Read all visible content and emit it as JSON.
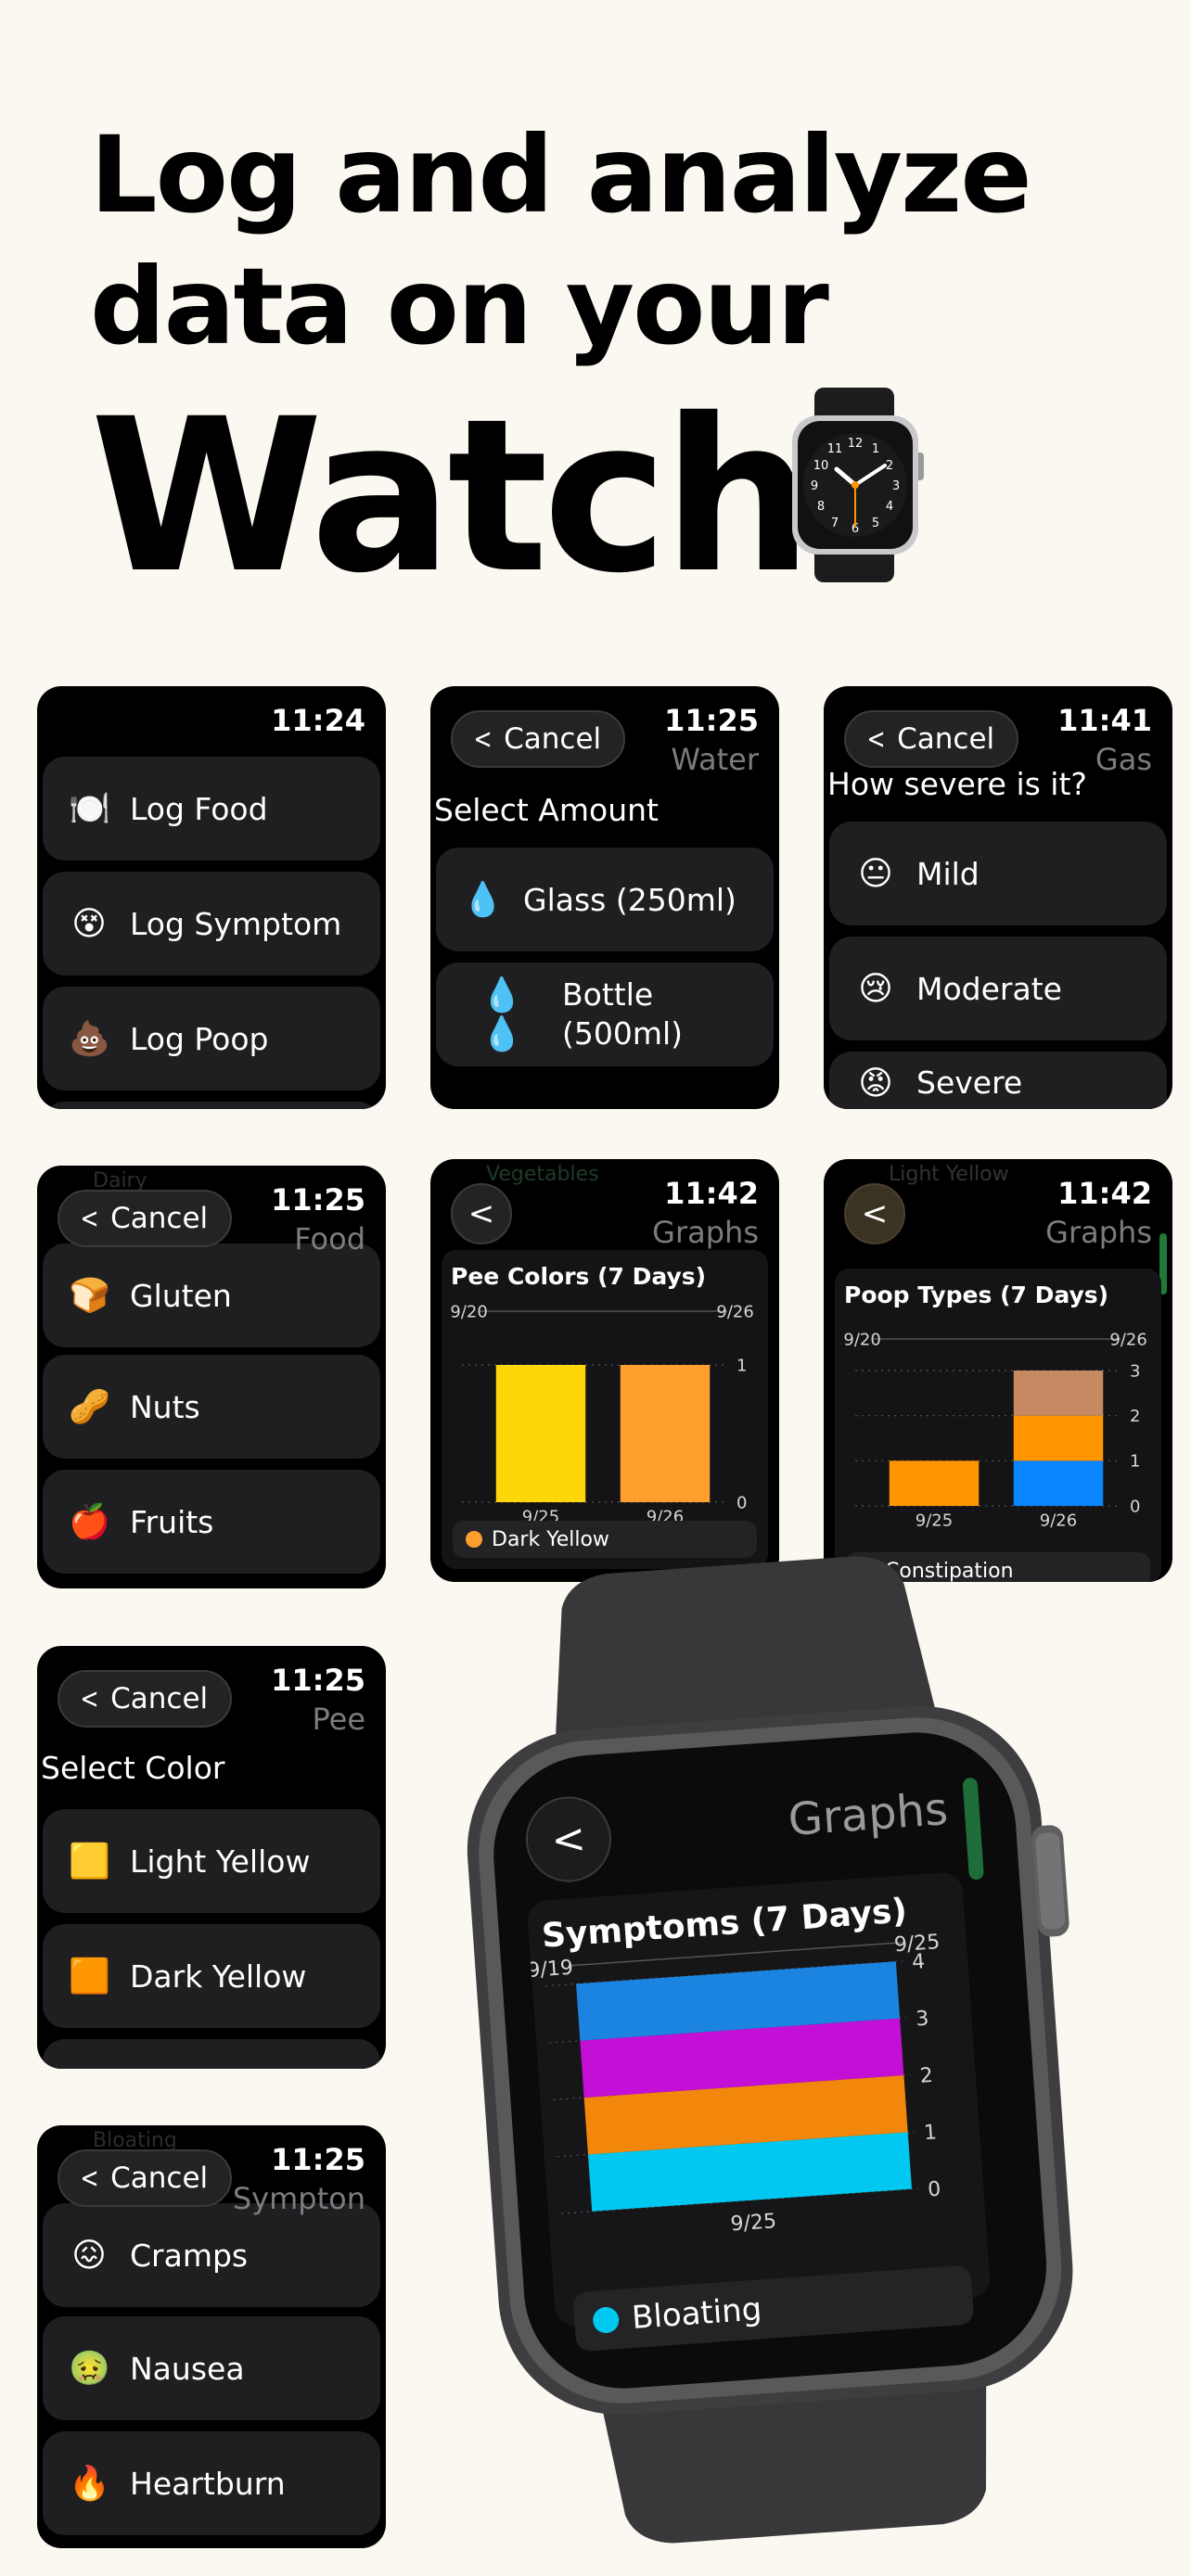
{
  "hero": {
    "line1": "Log and analyze",
    "line2": "data on your",
    "line3": "Watch"
  },
  "cancel_label": "Cancel",
  "s1": {
    "time": "11:24",
    "items": [
      {
        "icon": "🍽️",
        "icon_name": "plate-icon",
        "label": "Log Food"
      },
      {
        "icon": "😵",
        "icon_name": "dizzy-face-icon",
        "label": "Log Symptom"
      },
      {
        "icon": "💩",
        "icon_name": "poop-icon",
        "label": "Log Poop"
      }
    ]
  },
  "s2": {
    "time": "11:25",
    "subtitle": "Water",
    "heading": "Select Amount",
    "items": [
      {
        "icon": "💧",
        "icon_name": "droplet-icon",
        "label": "Glass (250ml)"
      },
      {
        "icon": "💧 💧",
        "icon_name": "two-droplets-icon",
        "label": "Bottle (500ml)"
      }
    ]
  },
  "s3": {
    "time": "11:41",
    "subtitle": "Gas",
    "heading": "How severe is it?",
    "items": [
      {
        "icon": "😐",
        "icon_name": "neutral-face-icon",
        "label": "Mild"
      },
      {
        "icon": "😢",
        "icon_name": "crying-face-icon",
        "label": "Moderate"
      },
      {
        "icon": "😡",
        "icon_name": "angry-face-icon",
        "label": "Severe"
      }
    ]
  },
  "s4": {
    "time": "11:25",
    "subtitle": "Food",
    "ghost": "Dairy",
    "items": [
      {
        "icon": "🍞",
        "icon_name": "bread-icon",
        "label": "Gluten"
      },
      {
        "icon": "🥜",
        "icon_name": "peanut-icon",
        "label": "Nuts"
      },
      {
        "icon": "🍎",
        "icon_name": "apple-icon",
        "label": "Fruits"
      }
    ]
  },
  "s5": {
    "time": "11:42",
    "subtitle": "Graphs",
    "ghost": "Vegetables",
    "chart_data": {
      "type": "bar",
      "title": "Pee Colors (7 Days)",
      "x_range": [
        "9/20",
        "9/26"
      ],
      "categories": [
        "9/25",
        "9/26"
      ],
      "series": [
        {
          "name": "Dark Yellow",
          "values": [
            1,
            1
          ]
        }
      ],
      "bar_colors": [
        "#FFD60A",
        "#FF9F2E"
      ],
      "yticks": [
        0,
        1
      ],
      "ylim": [
        0,
        1
      ],
      "legend": "bottom"
    }
  },
  "s6": {
    "time": "11:42",
    "subtitle": "Graphs",
    "ghost": "Light Yellow",
    "chart_data": {
      "type": "bar",
      "title": "Poop Types (7 Days)",
      "x_range": [
        "9/20",
        "9/26"
      ],
      "categories": [
        "9/25",
        "9/26"
      ],
      "series": [
        {
          "name": "Constipation",
          "values": [
            0,
            1
          ],
          "color": "#0A84FF"
        },
        {
          "values": [
            1,
            1
          ],
          "color": "#FF9500"
        },
        {
          "values": [
            0,
            1
          ],
          "color": "#C68A62"
        }
      ],
      "yticks": [
        0,
        1,
        2,
        3
      ],
      "ylim": [
        0,
        3
      ],
      "legend": "bottom"
    }
  },
  "s7": {
    "time": "11:25",
    "subtitle": "Pee",
    "heading": "Select Color",
    "items": [
      {
        "icon": "🟨",
        "icon_name": "yellow-square-icon",
        "label": "Light Yellow"
      },
      {
        "icon": "🟧",
        "icon_name": "orange-square-icon",
        "label": "Dark Yellow"
      }
    ]
  },
  "s8": {
    "time": "11:25",
    "subtitle": "Sympton",
    "ghost": "Bloating",
    "items": [
      {
        "icon": "😖",
        "icon_name": "confounded-face-icon",
        "label": "Cramps"
      },
      {
        "icon": "🤢",
        "icon_name": "nauseated-face-icon",
        "label": "Nausea"
      },
      {
        "icon": "🔥",
        "icon_name": "fire-icon",
        "label": "Heartburn"
      }
    ]
  },
  "watch": {
    "subtitle": "Graphs",
    "chart_data": {
      "type": "bar",
      "title": "Symptoms (7 Days)",
      "x_range": [
        "9/19",
        "9/25"
      ],
      "categories": [
        "9/25"
      ],
      "series": [
        {
          "name": "Bloating",
          "values": [
            1
          ],
          "color": "#00C8F0"
        },
        {
          "values": [
            1
          ],
          "color": "#F2870C"
        },
        {
          "values": [
            1
          ],
          "color": "#C40FD6"
        },
        {
          "values": [
            1
          ],
          "color": "#1A84E0"
        }
      ],
      "yticks": [
        0,
        1,
        2,
        3,
        4
      ],
      "ylim": [
        0,
        4
      ],
      "legend": "bottom"
    }
  }
}
